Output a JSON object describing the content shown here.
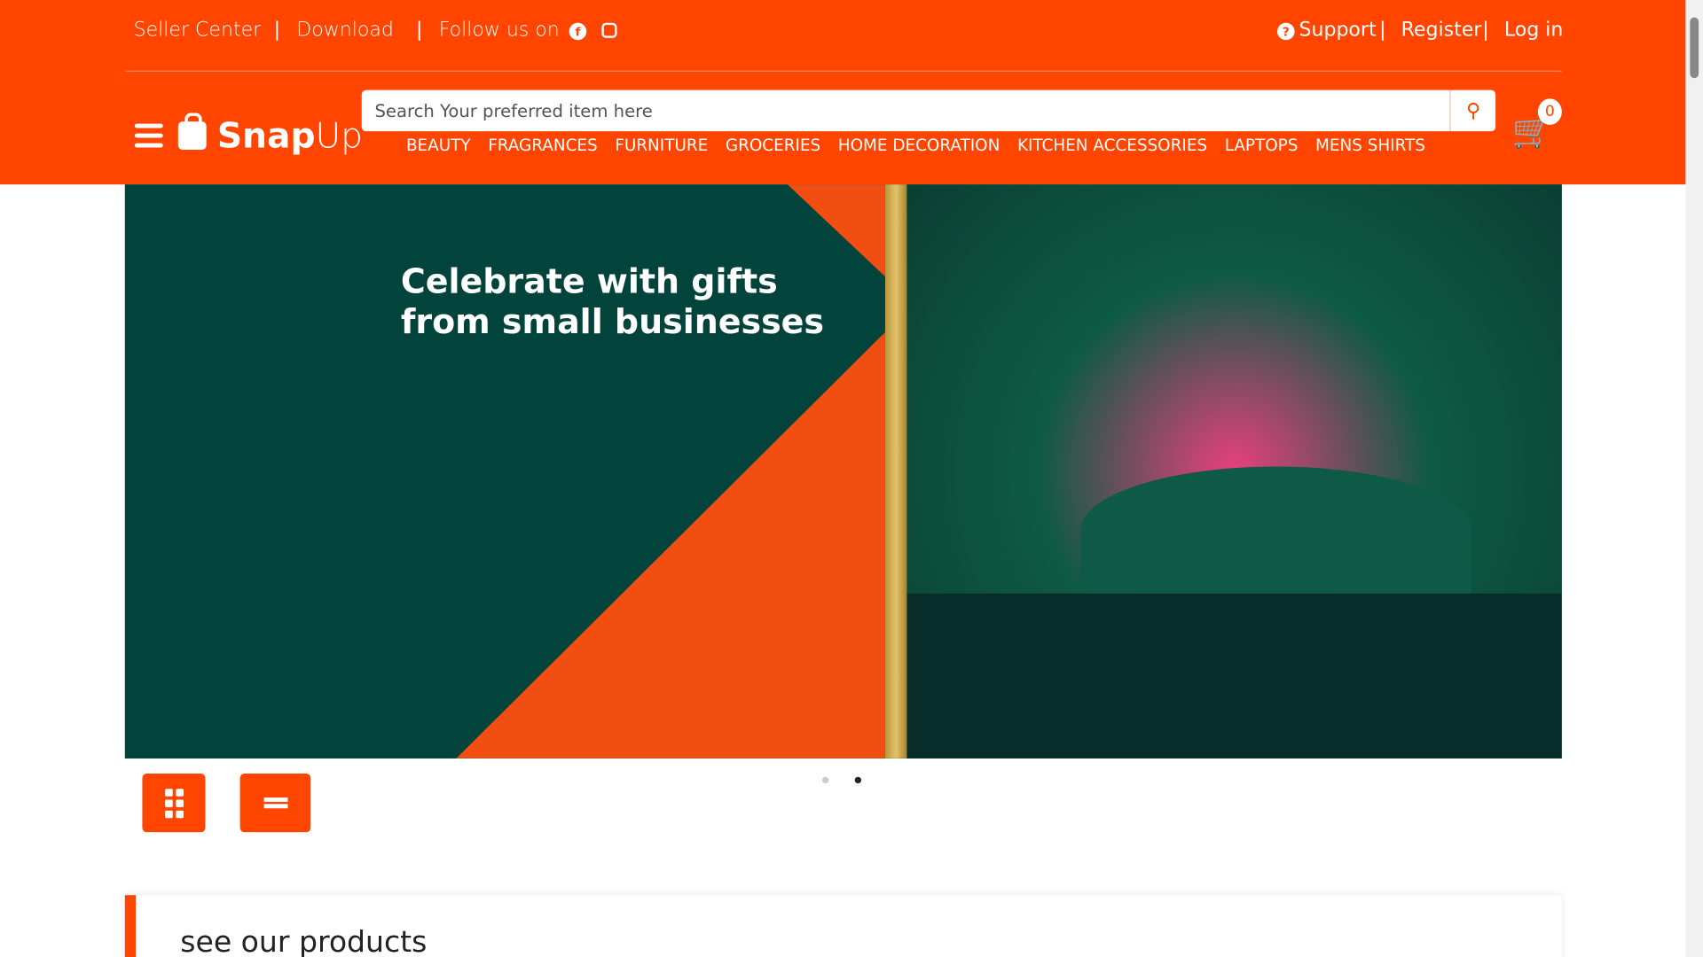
{
  "top_bar": {
    "seller_center": "Seller Center",
    "download": "Download",
    "follow_us": "Follow us on",
    "support": "Support",
    "register": "Register",
    "login": "Log in",
    "separator": "|"
  },
  "brand": {
    "name_bold": "Snap",
    "name_light": "Up"
  },
  "search": {
    "placeholder": "Search Your preferred item here",
    "value": ""
  },
  "categories": [
    "BEAUTY",
    "FRAGRANCES",
    "FURNITURE",
    "GROCERIES",
    "HOME DECORATION",
    "KITCHEN ACCESSORIES",
    "LAPTOPS",
    "MENS SHIRTS"
  ],
  "cart": {
    "count": "0"
  },
  "banner": {
    "line1": "Celebrate with gifts",
    "line2": "from small businesses",
    "slides": 2,
    "active_slide": 2
  },
  "products": {
    "title": "see our products"
  },
  "colors": {
    "brand": "#ff4500",
    "banner_green": "#02443c",
    "banner_orange": "#f24e12"
  }
}
